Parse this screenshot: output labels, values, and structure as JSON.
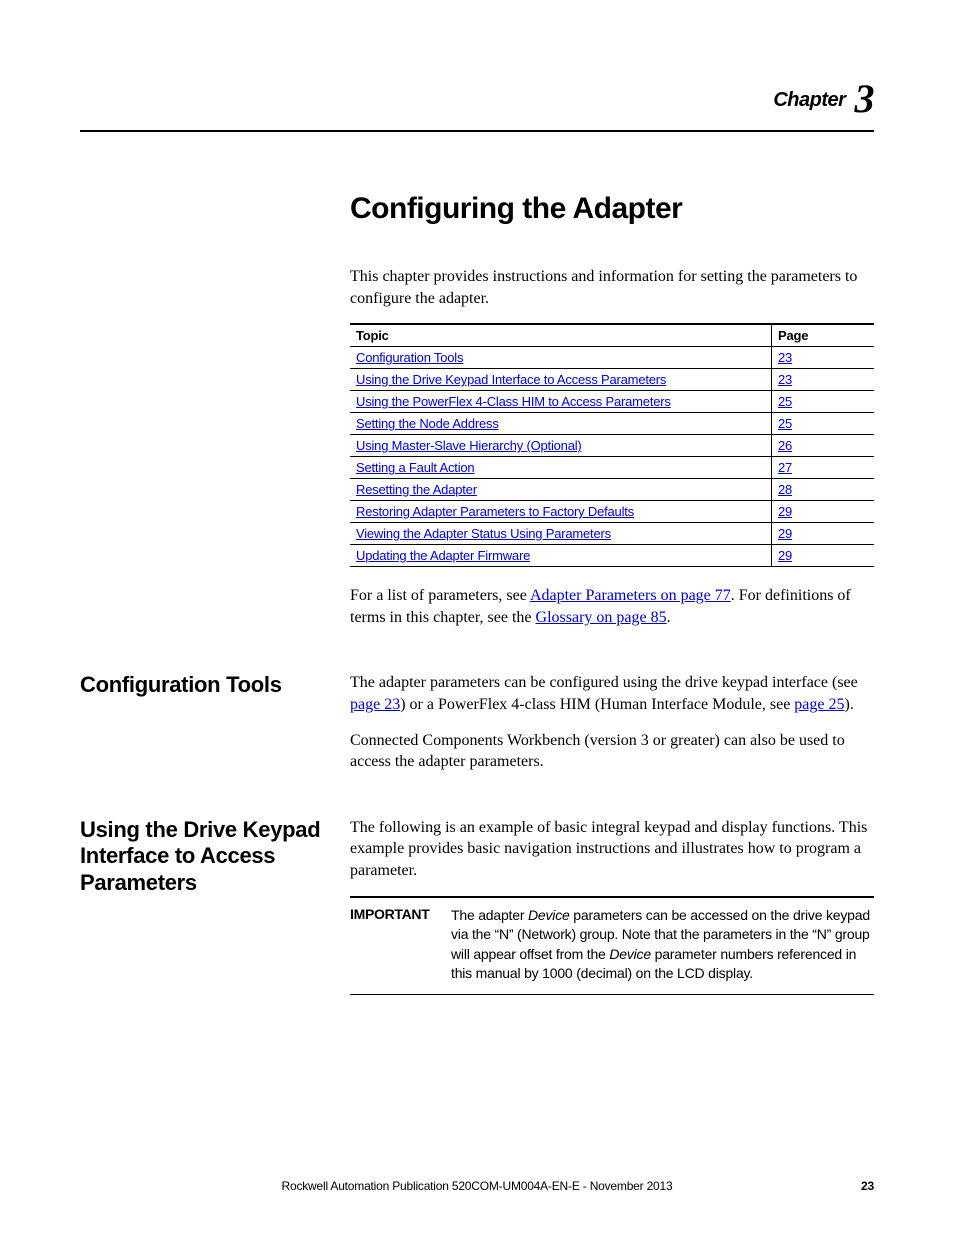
{
  "header": {
    "chapter_word": "Chapter",
    "chapter_num": "3"
  },
  "title": "Configuring the Adapter",
  "intro": "This chapter provides instructions and information for setting the parameters to configure the adapter.",
  "topic_table": {
    "headers": {
      "topic": "Topic",
      "page": "Page"
    },
    "rows": [
      {
        "topic": "Configuration Tools",
        "page": "23"
      },
      {
        "topic": "Using the Drive Keypad Interface to Access Parameters",
        "page": "23"
      },
      {
        "topic": "Using the PowerFlex 4-Class HIM to Access Parameters",
        "page": "25"
      },
      {
        "topic": "Setting the Node Address",
        "page": "25"
      },
      {
        "topic": "Using Master-Slave Hierarchy (Optional)",
        "page": "26"
      },
      {
        "topic": "Setting a Fault Action",
        "page": "27"
      },
      {
        "topic": "Resetting the Adapter",
        "page": "28"
      },
      {
        "topic": "Restoring Adapter Parameters to Factory Defaults",
        "page": "29"
      },
      {
        "topic": "Viewing the Adapter Status Using Parameters",
        "page": "29"
      },
      {
        "topic": "Updating the Adapter Firmware",
        "page": "29"
      }
    ]
  },
  "xref": {
    "pre1": "For a list of parameters, see ",
    "link1": "Adapter Parameters on page 77",
    "mid": ". For definitions of terms in this chapter, see the ",
    "link2": "Glossary on page 85",
    "post": "."
  },
  "sections": {
    "config_tools": {
      "heading": "Configuration Tools",
      "p1_pre": "The adapter parameters can be configured using the drive keypad interface (see ",
      "p1_link1": "page 23",
      "p1_mid": ") or a PowerFlex 4-class HIM (Human Interface Module, see ",
      "p1_link2": "page 25",
      "p1_post": ").",
      "p2": "Connected Components Workbench (version 3 or greater) can also be used to access the adapter parameters."
    },
    "keypad": {
      "heading": "Using the Drive Keypad Interface to Access Parameters",
      "p1": "The following is an example of basic integral keypad and display functions. This example provides basic navigation instructions and illustrates how to program a parameter.",
      "important_label": "IMPORTANT",
      "important_pre": "The adapter ",
      "important_em1": "Device",
      "important_mid1": " parameters can be accessed on the drive keypad via the “N” (Network) group. Note that the parameters in the “N” group will appear offset from the ",
      "important_em2": "Device",
      "important_mid2": " parameter numbers referenced in this manual by 1000 (decimal) on the LCD display."
    }
  },
  "footer": {
    "publication": "Rockwell Automation Publication 520COM-UM004A-EN-E - November 2013",
    "page": "23"
  }
}
